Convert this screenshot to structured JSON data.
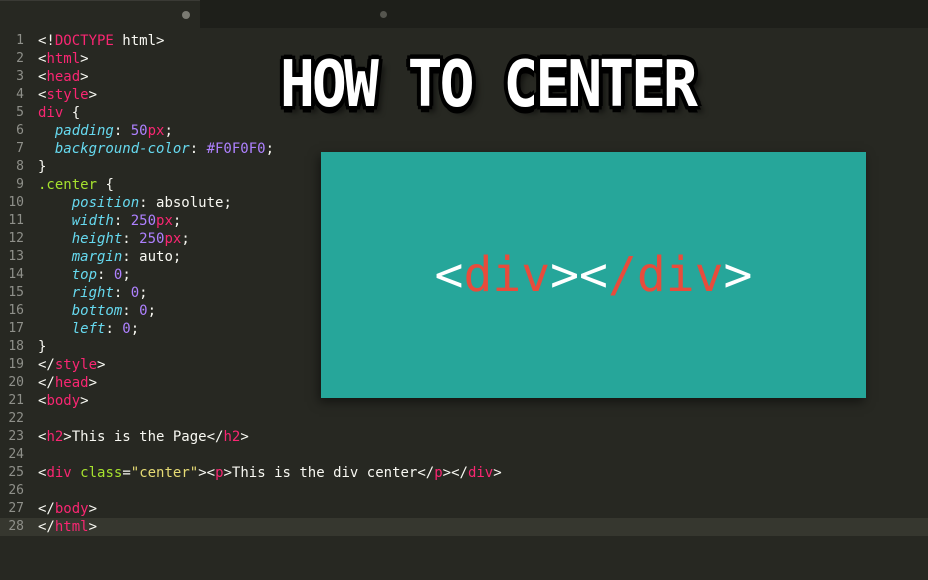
{
  "tab": {
    "modified": true
  },
  "lineCount": 28,
  "activeLine": 28,
  "code": [
    [
      {
        "c": "p-white",
        "t": "<!"
      },
      {
        "c": "p-red",
        "t": "DOCTYPE"
      },
      {
        "c": "p-white",
        "t": " html>"
      }
    ],
    [
      {
        "c": "p-white",
        "t": "<"
      },
      {
        "c": "p-red",
        "t": "html"
      },
      {
        "c": "p-white",
        "t": ">"
      }
    ],
    [
      {
        "c": "p-white",
        "t": "<"
      },
      {
        "c": "p-red",
        "t": "head"
      },
      {
        "c": "p-white",
        "t": ">"
      }
    ],
    [
      {
        "c": "p-white",
        "t": "<"
      },
      {
        "c": "p-red",
        "t": "style"
      },
      {
        "c": "p-white",
        "t": ">"
      }
    ],
    [
      {
        "c": "p-red",
        "t": "div"
      },
      {
        "c": "p-white",
        "t": " {"
      }
    ],
    [
      {
        "c": "p-white",
        "t": "  "
      },
      {
        "c": "p-blue",
        "t": "padding"
      },
      {
        "c": "p-white",
        "t": ": "
      },
      {
        "c": "p-purple",
        "t": "50"
      },
      {
        "c": "p-red",
        "t": "px"
      },
      {
        "c": "p-white",
        "t": ";"
      }
    ],
    [
      {
        "c": "p-white",
        "t": "  "
      },
      {
        "c": "p-blue",
        "t": "background-color"
      },
      {
        "c": "p-white",
        "t": ": "
      },
      {
        "c": "p-purple",
        "t": "#F0F0F0"
      },
      {
        "c": "p-white",
        "t": ";"
      }
    ],
    [
      {
        "c": "p-white",
        "t": "}"
      }
    ],
    [
      {
        "c": "p-green",
        "t": ".center"
      },
      {
        "c": "p-white",
        "t": " {"
      }
    ],
    [
      {
        "c": "p-white",
        "t": "    "
      },
      {
        "c": "p-blue",
        "t": "position"
      },
      {
        "c": "p-white",
        "t": ": absolute;"
      }
    ],
    [
      {
        "c": "p-white",
        "t": "    "
      },
      {
        "c": "p-blue",
        "t": "width"
      },
      {
        "c": "p-white",
        "t": ": "
      },
      {
        "c": "p-purple",
        "t": "250"
      },
      {
        "c": "p-red",
        "t": "px"
      },
      {
        "c": "p-white",
        "t": ";"
      }
    ],
    [
      {
        "c": "p-white",
        "t": "    "
      },
      {
        "c": "p-blue",
        "t": "height"
      },
      {
        "c": "p-white",
        "t": ": "
      },
      {
        "c": "p-purple",
        "t": "250"
      },
      {
        "c": "p-red",
        "t": "px"
      },
      {
        "c": "p-white",
        "t": ";"
      }
    ],
    [
      {
        "c": "p-white",
        "t": "    "
      },
      {
        "c": "p-blue",
        "t": "margin"
      },
      {
        "c": "p-white",
        "t": ": auto;"
      }
    ],
    [
      {
        "c": "p-white",
        "t": "    "
      },
      {
        "c": "p-blue",
        "t": "top"
      },
      {
        "c": "p-white",
        "t": ": "
      },
      {
        "c": "p-purple",
        "t": "0"
      },
      {
        "c": "p-white",
        "t": ";"
      }
    ],
    [
      {
        "c": "p-white",
        "t": "    "
      },
      {
        "c": "p-blue",
        "t": "right"
      },
      {
        "c": "p-white",
        "t": ": "
      },
      {
        "c": "p-purple",
        "t": "0"
      },
      {
        "c": "p-white",
        "t": ";"
      }
    ],
    [
      {
        "c": "p-white",
        "t": "    "
      },
      {
        "c": "p-blue",
        "t": "bottom"
      },
      {
        "c": "p-white",
        "t": ": "
      },
      {
        "c": "p-purple",
        "t": "0"
      },
      {
        "c": "p-white",
        "t": ";"
      }
    ],
    [
      {
        "c": "p-white",
        "t": "    "
      },
      {
        "c": "p-blue",
        "t": "left"
      },
      {
        "c": "p-white",
        "t": ": "
      },
      {
        "c": "p-purple",
        "t": "0"
      },
      {
        "c": "p-white",
        "t": ";"
      }
    ],
    [
      {
        "c": "p-white",
        "t": "}"
      }
    ],
    [
      {
        "c": "p-white",
        "t": "</"
      },
      {
        "c": "p-red",
        "t": "style"
      },
      {
        "c": "p-white",
        "t": ">"
      }
    ],
    [
      {
        "c": "p-white",
        "t": "</"
      },
      {
        "c": "p-red",
        "t": "head"
      },
      {
        "c": "p-white",
        "t": ">"
      }
    ],
    [
      {
        "c": "p-white",
        "t": "<"
      },
      {
        "c": "p-red",
        "t": "body"
      },
      {
        "c": "p-white",
        "t": ">"
      }
    ],
    [
      {
        "c": "p-white",
        "t": ""
      }
    ],
    [
      {
        "c": "p-white",
        "t": "<"
      },
      {
        "c": "p-red",
        "t": "h2"
      },
      {
        "c": "p-white",
        "t": ">This is the Page</"
      },
      {
        "c": "p-red",
        "t": "h2"
      },
      {
        "c": "p-white",
        "t": ">"
      }
    ],
    [
      {
        "c": "p-white",
        "t": ""
      }
    ],
    [
      {
        "c": "p-white",
        "t": "<"
      },
      {
        "c": "p-red",
        "t": "div"
      },
      {
        "c": "p-white",
        "t": " "
      },
      {
        "c": "p-green",
        "t": "class"
      },
      {
        "c": "p-white",
        "t": "="
      },
      {
        "c": "p-yellow",
        "t": "\"center\""
      },
      {
        "c": "p-white",
        "t": "><"
      },
      {
        "c": "p-red",
        "t": "p"
      },
      {
        "c": "p-white",
        "t": ">This is the div center</"
      },
      {
        "c": "p-red",
        "t": "p"
      },
      {
        "c": "p-white",
        "t": "></"
      },
      {
        "c": "p-red",
        "t": "div"
      },
      {
        "c": "p-white",
        "t": ">"
      }
    ],
    [
      {
        "c": "p-white",
        "t": ""
      }
    ],
    [
      {
        "c": "p-white",
        "t": "</"
      },
      {
        "c": "p-red",
        "t": "body"
      },
      {
        "c": "p-white",
        "t": ">"
      }
    ],
    [
      {
        "c": "p-white",
        "t": "</"
      },
      {
        "c": "p-red",
        "t": "html"
      },
      {
        "c": "p-white",
        "t": ">"
      }
    ]
  ],
  "overlay": {
    "title": "HOW TO CENTER",
    "panel_tokens": [
      {
        "c": "",
        "t": "<"
      },
      {
        "c": "red",
        "t": "div"
      },
      {
        "c": "",
        "t": ">"
      },
      {
        "c": "",
        "t": "<"
      },
      {
        "c": "red",
        "t": "/div"
      },
      {
        "c": "",
        "t": ">"
      }
    ]
  }
}
